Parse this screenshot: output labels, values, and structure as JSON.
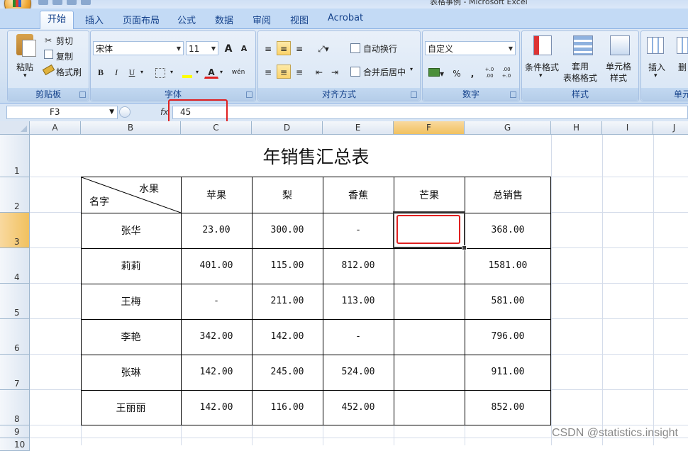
{
  "window": {
    "title_fragment": "表格事例 - Microsoft Excel"
  },
  "ribbon": {
    "tabs": [
      "开始",
      "插入",
      "页面布局",
      "公式",
      "数据",
      "审阅",
      "视图",
      "Acrobat"
    ],
    "clipboard": {
      "paste": "粘贴",
      "cut": "剪切",
      "copy": "复制",
      "format_painter": "格式刷",
      "label": "剪贴板"
    },
    "font": {
      "family": "宋体",
      "size": "11",
      "grow": "A",
      "shrink": "A",
      "bold": "B",
      "italic": "I",
      "underline": "U",
      "font_color": "A",
      "phonetic": "wén",
      "label": "字体"
    },
    "alignment": {
      "wrap": "自动换行",
      "merge": "合并后居中",
      "label": "对齐方式"
    },
    "number": {
      "format": "自定义",
      "percent": "%",
      "comma": ",",
      "inc_decimal": "+.0 .00",
      "dec_decimal": ".00 +.0",
      "label": "数字"
    },
    "styles": {
      "conditional": "条件格式",
      "table": "套用\n表格格式",
      "cell_styles": "单元格\n样式",
      "label": "样式"
    },
    "cells": {
      "insert": "插入",
      "delete": "删",
      "label": "单元"
    }
  },
  "formula_bar": {
    "name_box": "F3",
    "fx": "fx",
    "formula": "45"
  },
  "sheet": {
    "columns": [
      "A",
      "B",
      "C",
      "D",
      "E",
      "F",
      "G",
      "H",
      "I",
      "J"
    ],
    "rows": [
      "1",
      "2",
      "3",
      "4",
      "5",
      "6",
      "7",
      "8",
      "9",
      "10"
    ],
    "selected_cell": "F3",
    "title": "年销售汇总表",
    "header": {
      "diag_top": "水果",
      "diag_bottom": "名字",
      "cols": [
        "苹果",
        "梨",
        "香蕉",
        "芒果",
        "总销售"
      ]
    },
    "data": [
      {
        "name": "张华",
        "apple": "23.00",
        "pear": "300.00",
        "banana": "-",
        "mango": "",
        "total": "368.00"
      },
      {
        "name": "莉莉",
        "apple": "401.00",
        "pear": "115.00",
        "banana": "812.00",
        "mango": "",
        "total": "1581.00"
      },
      {
        "name": "王梅",
        "apple": "-",
        "pear": "211.00",
        "banana": "113.00",
        "mango": "",
        "total": "581.00"
      },
      {
        "name": "李艳",
        "apple": "342.00",
        "pear": "142.00",
        "banana": "-",
        "mango": "",
        "total": "796.00"
      },
      {
        "name": "张琳",
        "apple": "142.00",
        "pear": "245.00",
        "banana": "524.00",
        "mango": "",
        "total": "911.00"
      },
      {
        "name": "王丽丽",
        "apple": "142.00",
        "pear": "116.00",
        "banana": "452.00",
        "mango": "",
        "total": "852.00"
      }
    ]
  },
  "watermark": "CSDN @statistics.insight",
  "colors": {
    "ribbon_bg": "#dfe9f5",
    "highlight": "#e02020",
    "selected_header": "#f1c15f"
  }
}
